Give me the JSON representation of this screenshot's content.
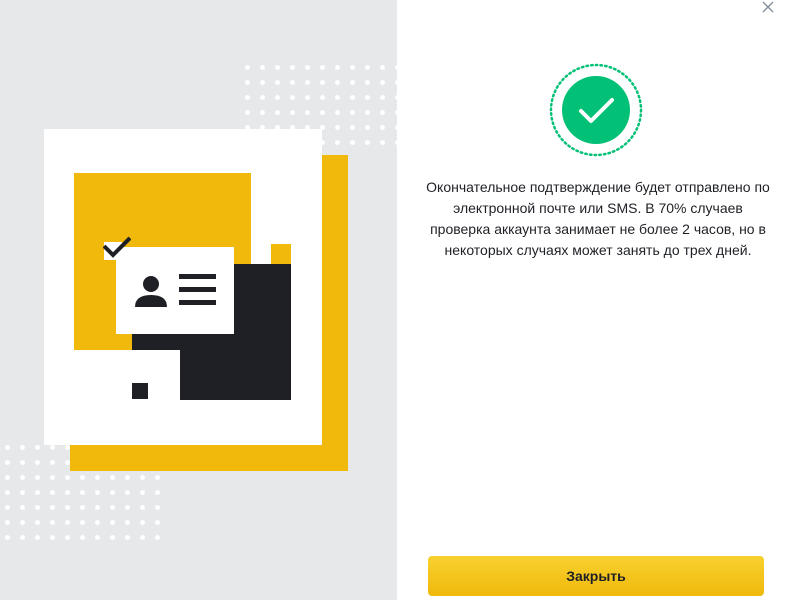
{
  "dialog": {
    "message": "Окончательное подтверждение будет отправлено по электронной почте или SMS. В 70% случаев проверка аккаунта занимает не более 2 часов, но в некоторых случаях может занять до трех дней.",
    "close_button_label": "Закрыть"
  },
  "icons": {
    "close": "close-icon",
    "success": "check-circle-icon",
    "illustration": "id-verification-illustration"
  },
  "colors": {
    "accent": "#f0b90b",
    "success": "#02c076",
    "text": "#1e2026",
    "panel": "#e6e8ea"
  }
}
